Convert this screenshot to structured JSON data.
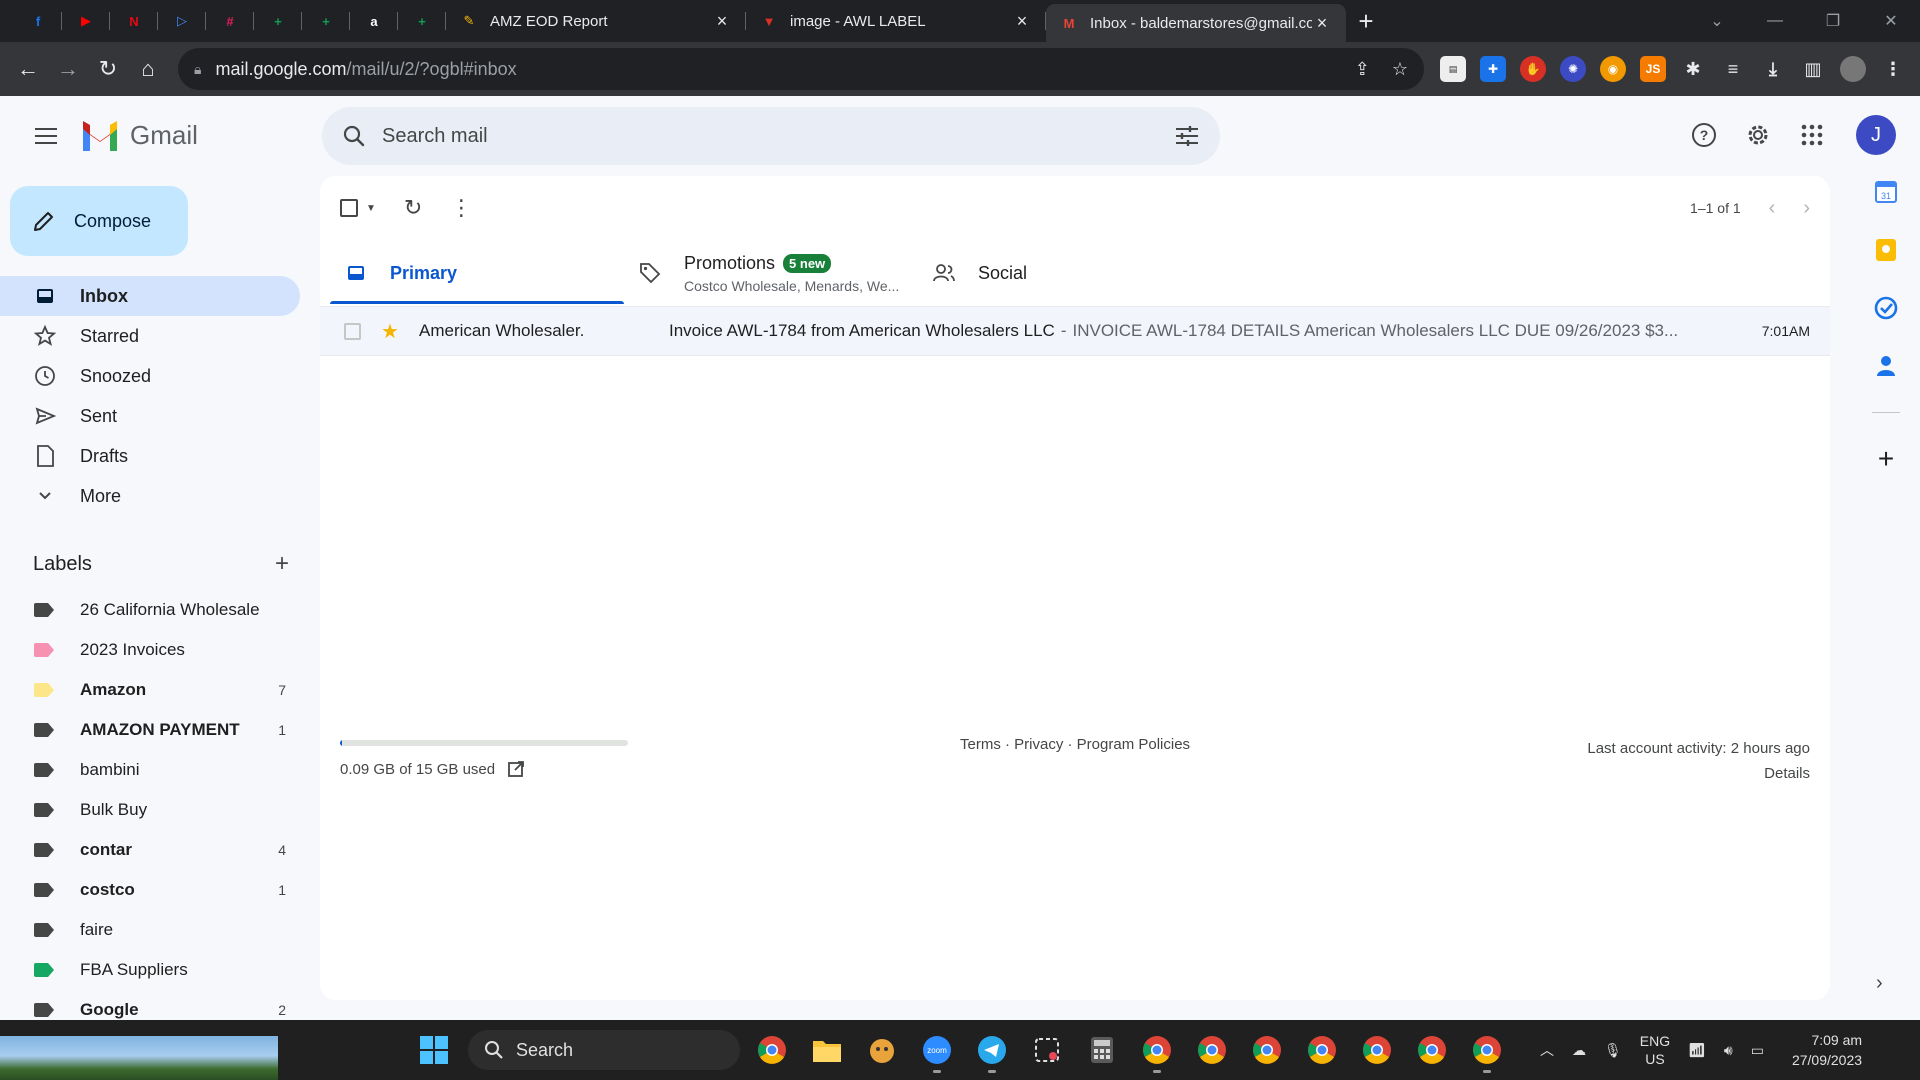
{
  "browser": {
    "pinned_tabs": [
      {
        "icon": "facebook-icon",
        "glyph": "f",
        "color": "#1877f2"
      },
      {
        "icon": "youtube-icon",
        "glyph": "▶",
        "color": "#ff0000"
      },
      {
        "icon": "netflix-icon",
        "glyph": "N",
        "color": "#e50914"
      },
      {
        "icon": "play-icon",
        "glyph": "▷",
        "color": "#4285f4"
      },
      {
        "icon": "slack-icon",
        "glyph": "#",
        "color": "#e01e5a"
      },
      {
        "icon": "sheets-icon",
        "glyph": "+",
        "color": "#0f9d58"
      },
      {
        "icon": "sheets-icon",
        "glyph": "+",
        "color": "#0f9d58"
      },
      {
        "icon": "amazon-icon",
        "glyph": "a",
        "color": "#ffffff"
      },
      {
        "icon": "sheets-icon",
        "glyph": "+",
        "color": "#0f9d58"
      }
    ],
    "tabs": [
      {
        "title": "AMZ EOD Report",
        "icon": "apps-script-icon",
        "active": false
      },
      {
        "title": "image - AWL LABEL",
        "icon": "awl-icon",
        "active": false
      },
      {
        "title": "Inbox - baldemarstores@gmail.com - Gmail",
        "icon": "gmail-icon",
        "active": true
      }
    ],
    "url_host": "mail.google.com",
    "url_path": "/mail/u/2/?ogbl#inbox"
  },
  "gmail": {
    "product_name": "Gmail",
    "search_placeholder": "Search mail",
    "avatar_letter": "J",
    "compose_label": "Compose",
    "nav": [
      {
        "label": "Inbox",
        "icon": "inbox-icon",
        "active": true
      },
      {
        "label": "Starred",
        "icon": "star-icon",
        "active": false
      },
      {
        "label": "Snoozed",
        "icon": "clock-icon",
        "active": false
      },
      {
        "label": "Sent",
        "icon": "send-icon",
        "active": false
      },
      {
        "label": "Drafts",
        "icon": "draft-icon",
        "active": false
      },
      {
        "label": "More",
        "icon": "chevron-down-icon",
        "active": false
      }
    ],
    "labels_heading": "Labels",
    "labels": [
      {
        "name": "26 California Wholesale",
        "count": "",
        "color": "#444746",
        "bold": false
      },
      {
        "name": "2023 Invoices",
        "count": "",
        "color": "#f691b2",
        "bold": false
      },
      {
        "name": "Amazon",
        "count": "7",
        "color": "#fde68a",
        "bold": true
      },
      {
        "name": "AMAZON PAYMENT",
        "count": "1",
        "color": "#444746",
        "bold": true
      },
      {
        "name": "bambini",
        "count": "",
        "color": "#444746",
        "bold": false
      },
      {
        "name": "Bulk Buy",
        "count": "",
        "color": "#444746",
        "bold": false
      },
      {
        "name": "contar",
        "count": "4",
        "color": "#444746",
        "bold": true
      },
      {
        "name": "costco",
        "count": "1",
        "color": "#444746",
        "bold": true
      },
      {
        "name": "faire",
        "count": "",
        "color": "#444746",
        "bold": false
      },
      {
        "name": "FBA Suppliers",
        "count": "",
        "color": "#16a765",
        "bold": false
      },
      {
        "name": "Google",
        "count": "2",
        "color": "#444746",
        "bold": true
      }
    ],
    "pager": "1–1 of 1",
    "category_tabs": [
      {
        "name": "Primary",
        "icon": "inbox-tab-icon",
        "active": true,
        "badge": "",
        "sub": ""
      },
      {
        "name": "Promotions",
        "icon": "tag-icon",
        "active": false,
        "badge": "5 new",
        "sub": "Costco Wholesale, Menards, We..."
      },
      {
        "name": "Social",
        "icon": "people-icon",
        "active": false,
        "badge": "",
        "sub": ""
      }
    ],
    "emails": [
      {
        "sender": "American Wholesaler.",
        "subject": "Invoice AWL-1784 from American Wholesalers LLC",
        "snippet": "INVOICE AWL-1784 DETAILS American Wholesalers LLC DUE 09/26/2023 $3...",
        "time": "7:01AM",
        "starred": true
      }
    ],
    "storage_text": "0.09 GB of 15 GB used",
    "storage_fraction": 0.006,
    "footer_links": "Terms · Privacy · Program Policies",
    "activity_line": "Last account activity: 2 hours ago",
    "details_link": "Details"
  },
  "taskbar": {
    "search_label": "Search",
    "lang_top": "ENG",
    "lang_bottom": "US",
    "time": "7:09 am",
    "date": "27/09/2023"
  }
}
